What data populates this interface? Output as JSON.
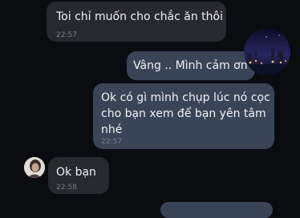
{
  "messages": [
    {
      "side": "in",
      "text": "Toi chỉ muốn cho chắc ăn thôi",
      "time": "22:57"
    },
    {
      "side": "out",
      "text": "Vâng .. Mình cảm ơn b"
    },
    {
      "side": "out",
      "lines": [
        "Ok có gì mình chụp lúc nó cọc",
        "cho bạn xem để bạn yên tâm",
        "nhé"
      ],
      "time": "22:57"
    },
    {
      "side": "in",
      "text": "Ok bạn",
      "time": "22:58"
    }
  ],
  "colors": {
    "background": "#0b0c10",
    "incoming_bubble": "#27292f",
    "outgoing_bubble": "#3a4457",
    "timestamp": "#7b7f88"
  },
  "avatars": {
    "self": "city-night-photo-avatar",
    "contact": "person-photo-avatar"
  }
}
